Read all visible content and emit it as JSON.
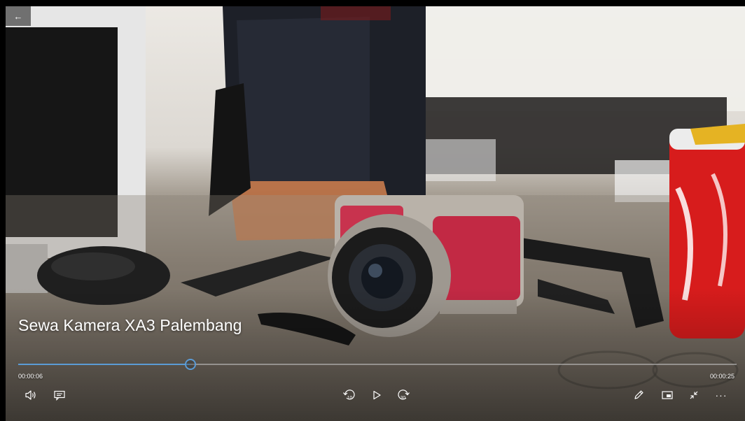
{
  "video": {
    "title": "Sewa Kamera XA3 Palembang",
    "elapsed": "00:00:06",
    "duration": "00:00:25",
    "progress": 0.24
  },
  "back_button": {
    "icon": "back-arrow-icon",
    "glyph": "←"
  },
  "controls": {
    "left": [
      "volume-icon",
      "subtitles-icon"
    ],
    "center": [
      "skip-back-10-icon",
      "play-icon",
      "skip-forward-30-icon"
    ],
    "right": [
      "edit-pen-icon",
      "mini-view-icon",
      "exit-fullscreen-icon",
      "more-options-icon"
    ],
    "skip_back_seconds": "10",
    "skip_forward_seconds": "30",
    "more_glyph": "···"
  },
  "colors": {
    "accent": "#5b9bd5",
    "text": "#ffffff"
  }
}
